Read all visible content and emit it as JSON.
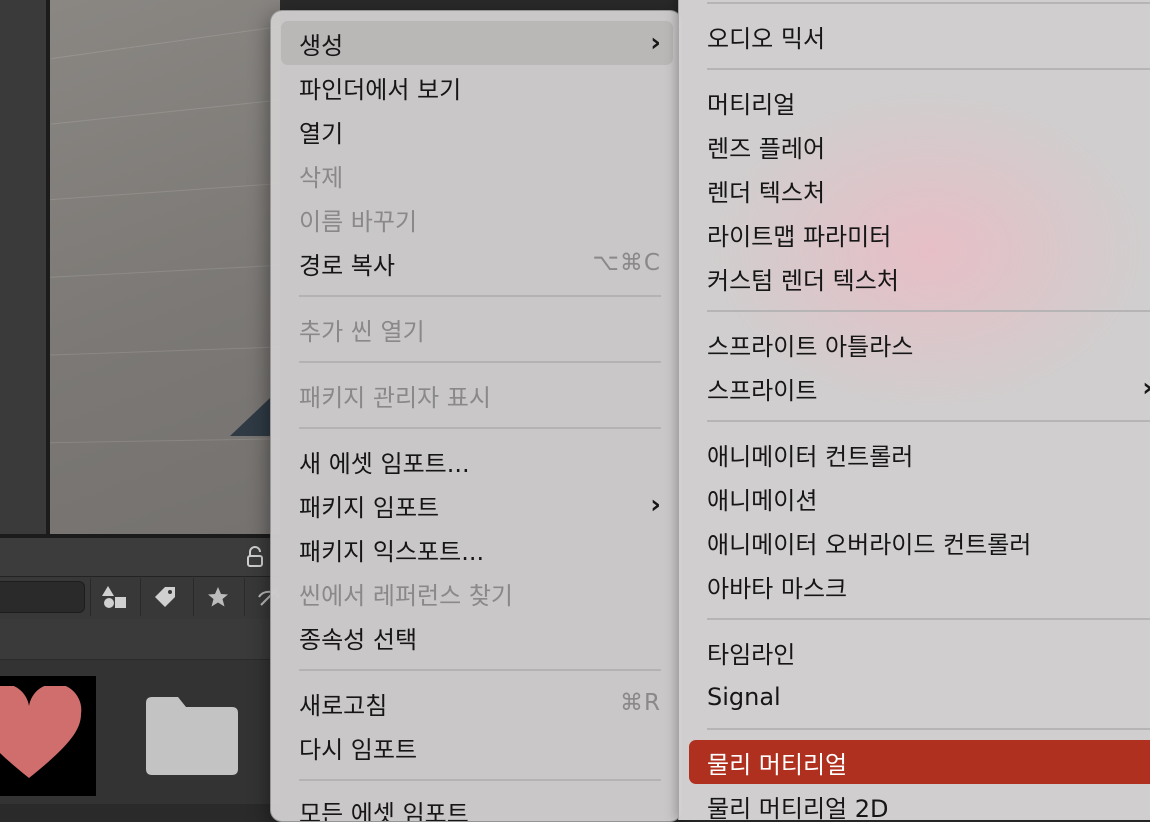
{
  "background": {
    "lock_icon": "lock-icon",
    "toolbar_icons": [
      "shapes-icon",
      "tag-icon",
      "star-icon",
      "eye-off-icon"
    ],
    "assets": [
      "heart-icon",
      "folder-icon"
    ]
  },
  "context_menu": {
    "items": [
      {
        "label": "생성",
        "submenu": true,
        "highlighted": true
      },
      {
        "label": "파인더에서 보기"
      },
      {
        "label": "열기"
      },
      {
        "label": "삭제",
        "disabled": true
      },
      {
        "label": "이름 바꾸기",
        "disabled": true
      },
      {
        "label": "경로 복사",
        "shortcut": "⌥⌘C"
      },
      {
        "label": "추가 씬 열기",
        "disabled": true
      },
      {
        "label": "패키지 관리자 표시",
        "disabled": true
      },
      {
        "label": "새 에셋 임포트..."
      },
      {
        "label": "패키지 임포트",
        "submenu": true
      },
      {
        "label": "패키지 익스포트..."
      },
      {
        "label": "씬에서 레퍼런스 찾기",
        "disabled": true
      },
      {
        "label": "종속성 선택"
      },
      {
        "label": "새로고침",
        "shortcut": "⌘R"
      },
      {
        "label": "다시 임포트"
      },
      {
        "label": "모든 에셋 임포트"
      }
    ]
  },
  "create_submenu": {
    "items": [
      {
        "label": "오디오 믹서"
      },
      {
        "label": "머티리얼"
      },
      {
        "label": "렌즈 플레어"
      },
      {
        "label": "렌더 텍스처"
      },
      {
        "label": "라이트맵 파라미터"
      },
      {
        "label": "커스텀 렌더 텍스처"
      },
      {
        "label": "스프라이트 아틀라스"
      },
      {
        "label": "스프라이트",
        "submenu": true
      },
      {
        "label": "애니메이터 컨트롤러"
      },
      {
        "label": "애니메이션"
      },
      {
        "label": "애니메이터 오버라이드 컨트롤러"
      },
      {
        "label": "아바타 마스크"
      },
      {
        "label": "타임라인"
      },
      {
        "label": "Signal"
      },
      {
        "label": "물리 머티리얼",
        "selected": true
      },
      {
        "label": "물리 머티리얼 2D"
      }
    ],
    "selected_color": "#b0301f"
  },
  "chevron": "›"
}
